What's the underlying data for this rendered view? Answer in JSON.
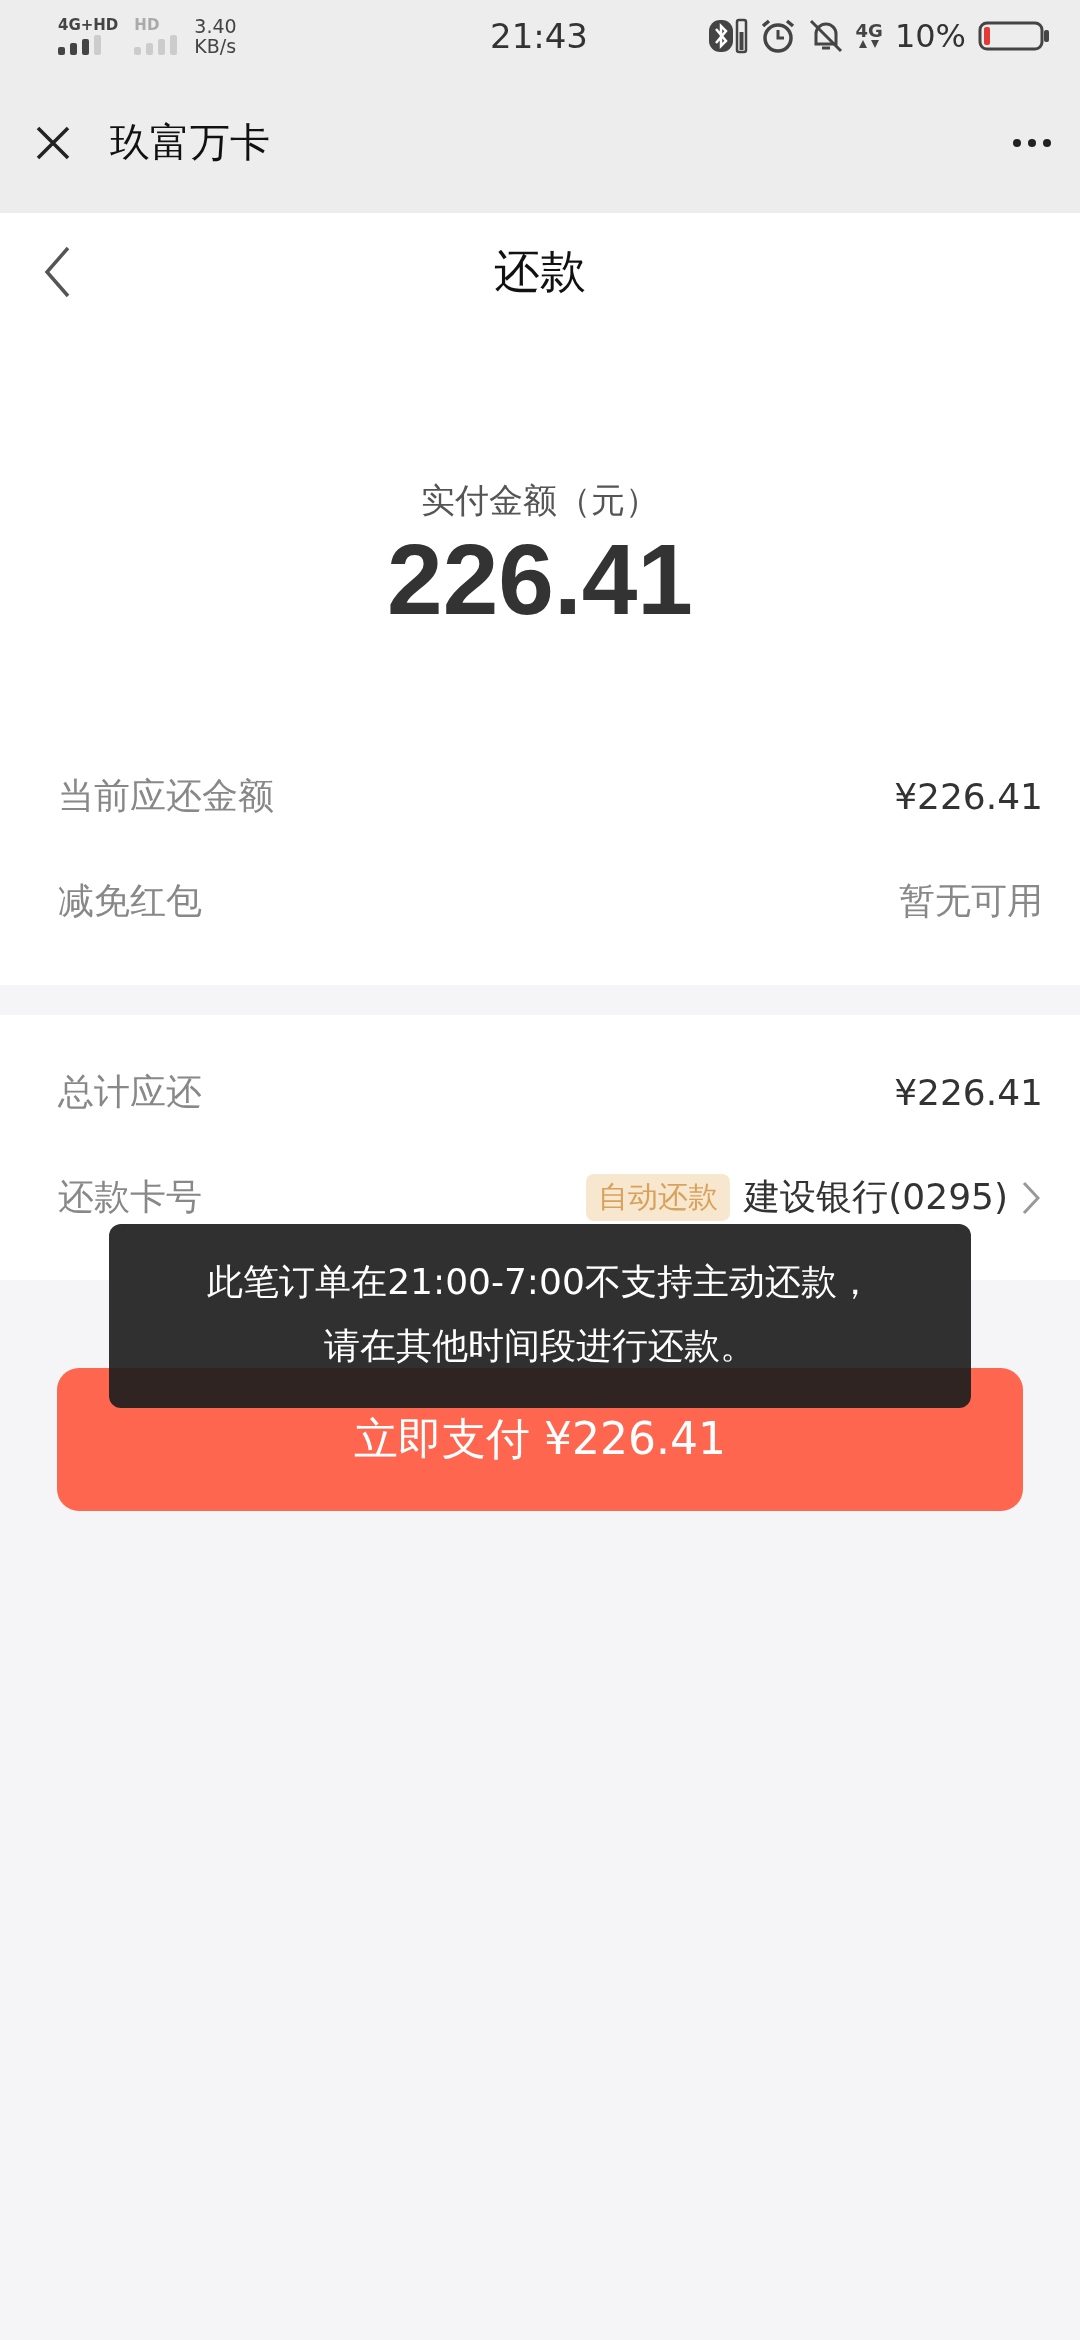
{
  "status_bar": {
    "network": "4G+HD",
    "network_2": "HD",
    "speed": "3.40",
    "speed_unit": "KB/s",
    "time": "21:43",
    "network_3": "4G",
    "battery": "10%"
  },
  "title_bar": {
    "title": "玖富万卡"
  },
  "page": {
    "title": "还款"
  },
  "amount": {
    "label": "实付金额（元）",
    "value": "226.41"
  },
  "rows_1": [
    {
      "label": "当前应还金额",
      "value": "¥226.41"
    },
    {
      "label": "减免红包",
      "value": "暂无可用"
    }
  ],
  "rows_2": [
    {
      "label": "总计应还",
      "value": "¥226.41"
    }
  ],
  "card_row": {
    "label": "还款卡号",
    "tag": "自动还款",
    "value": "建设银行(0295)"
  },
  "pay_button": "立即支付 ¥226.41",
  "toast": "此笔订单在21:00-7:00不支持主动还款，请在其他时间段进行还款。"
}
